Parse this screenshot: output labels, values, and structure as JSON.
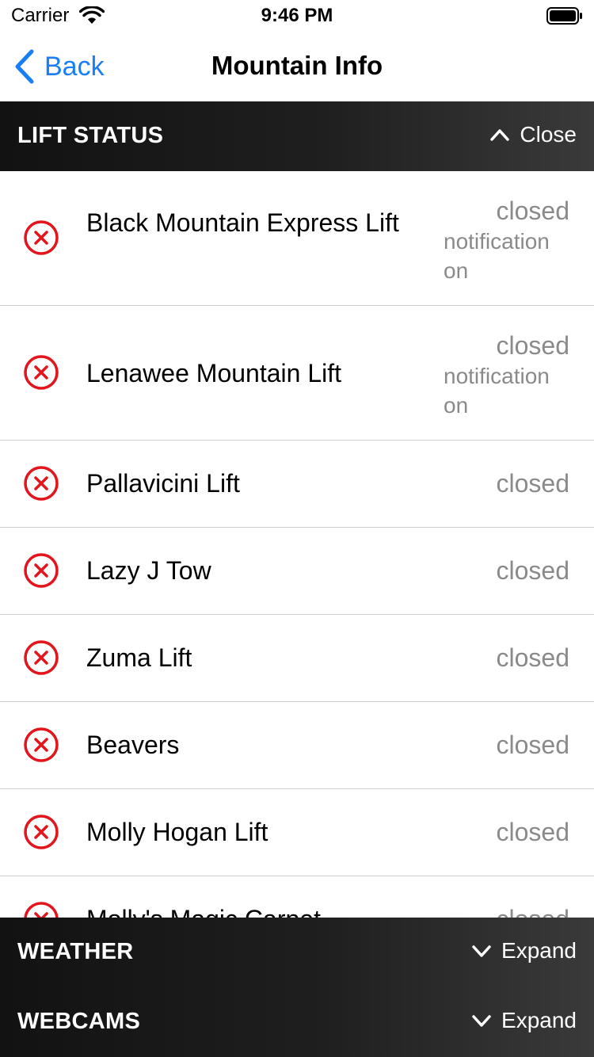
{
  "status_bar": {
    "carrier": "Carrier",
    "time": "9:46 PM"
  },
  "nav": {
    "back_label": "Back",
    "title": "Mountain Info"
  },
  "lift_status": {
    "title": "LIFT STATUS",
    "action": "Close",
    "lifts": [
      {
        "name": "Black Mountain Express Lift",
        "status": "closed",
        "notification": "notification on"
      },
      {
        "name": "Lenawee Mountain Lift",
        "status": "closed",
        "notification": "notification on"
      },
      {
        "name": "Pallavicini Lift",
        "status": "closed"
      },
      {
        "name": "Lazy J Tow",
        "status": "closed"
      },
      {
        "name": "Zuma Lift",
        "status": "closed"
      },
      {
        "name": "Beavers",
        "status": "closed"
      },
      {
        "name": "Molly Hogan Lift",
        "status": "closed"
      },
      {
        "name": "Molly's Magic Carpet",
        "status": "closed"
      }
    ]
  },
  "weather": {
    "title": "WEATHER",
    "action": "Expand"
  },
  "webcams": {
    "title": "WEBCAMS",
    "action": "Expand"
  },
  "colors": {
    "accent": "#1a7ff5",
    "closed_icon": "#e3141b",
    "status_text": "#8a8a8a"
  },
  "icons": {
    "lift_status_icon": "x-circle-icon",
    "back": "chevron-left-icon"
  }
}
